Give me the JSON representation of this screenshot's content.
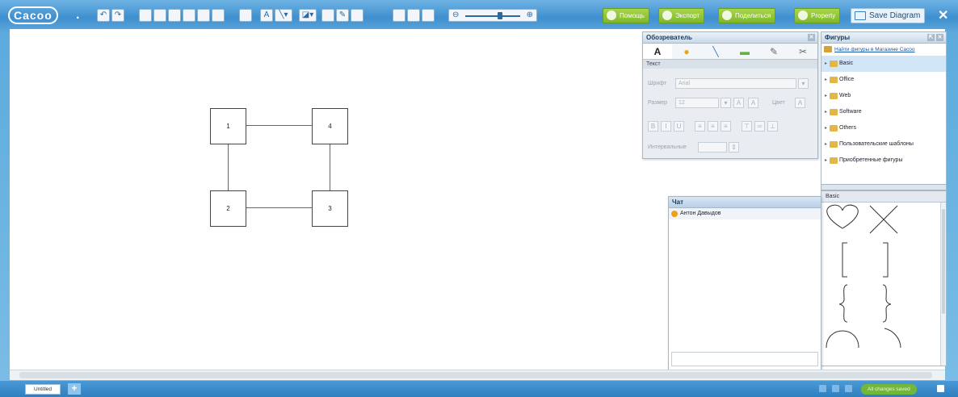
{
  "app": {
    "logo": "Cacoo"
  },
  "toolbar": {
    "help_label": "Помощь",
    "export_label": "Экспорт",
    "share_label": "Поделиться",
    "property_label": "Property",
    "save_label": "Save Diagram",
    "close_label": "✕"
  },
  "canvas": {
    "nodes": [
      "1",
      "4",
      "2",
      "3"
    ]
  },
  "inspector": {
    "title": "Обозреватель",
    "tabs": [
      "A",
      "●",
      "╲",
      "▬",
      "✎",
      "✂"
    ],
    "section": "Текст",
    "font_label": "Шрифт",
    "font_value": "Arial",
    "size_label": "Размер",
    "size_value": "12",
    "color_label": "Цвет",
    "spacing_label": "Интервальные"
  },
  "shapes": {
    "title": "Фигуры",
    "shop_link": "Найти фигуры в Магазине Cacoo",
    "categories": [
      "Basic",
      "Office",
      "Web",
      "Software",
      "Others",
      "Пользовательские шаблоны",
      "Приобретенные фигуры"
    ],
    "basic_title": "Basic"
  },
  "chat": {
    "title": "Чат",
    "user": "Антон Давыдов"
  },
  "bottom": {
    "page_tab": "Untitled",
    "add_label": "+",
    "status": "All changes saved"
  }
}
